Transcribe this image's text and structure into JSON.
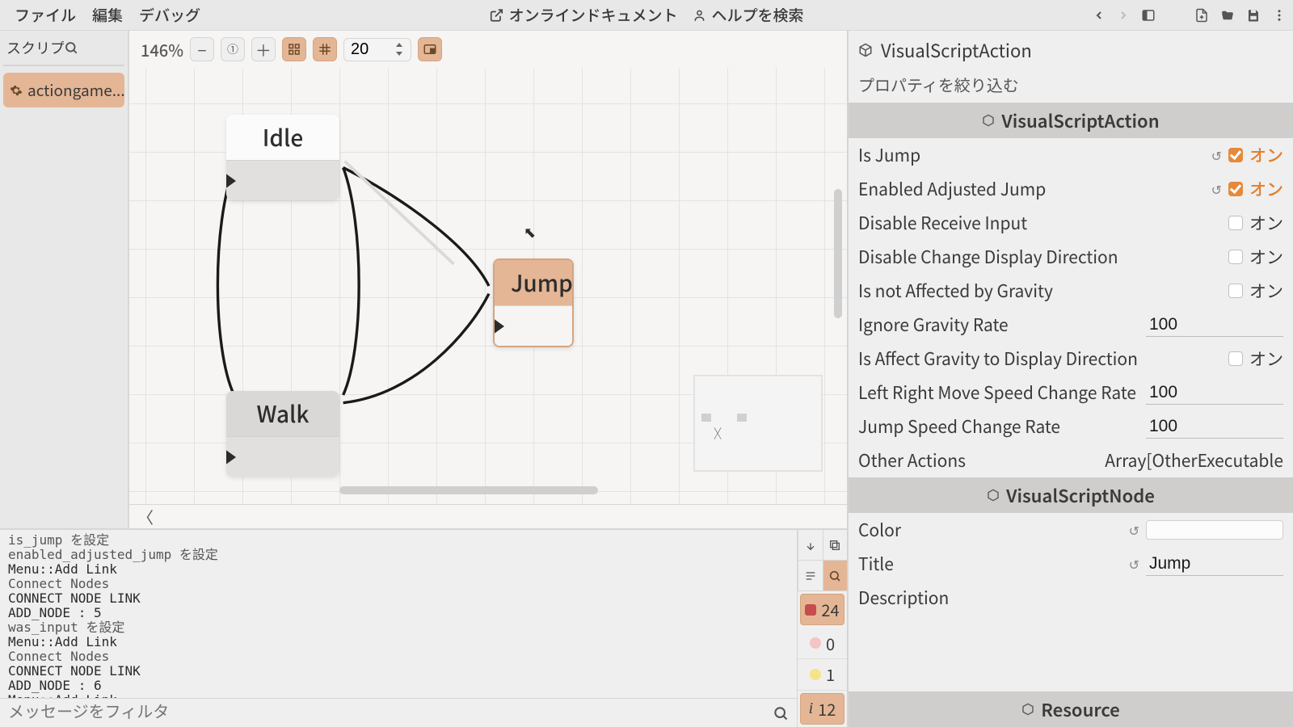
{
  "menu": {
    "file": "ファイル",
    "edit": "編集",
    "debug": "デバッグ",
    "online_docs": "オンラインドキュメント",
    "help": "ヘルプを検索"
  },
  "sidebar": {
    "search_label": "スクリプトを",
    "item": "actiongame..."
  },
  "canvas": {
    "zoom": "146%",
    "grid": "20",
    "nodes": {
      "idle": "Idle",
      "walk": "Walk",
      "jump": "Jump"
    }
  },
  "console": {
    "lines": [
      {
        "t": "is_jump を設定",
        "a": false
      },
      {
        "t": "enabled_adjusted_jump を設定",
        "a": false
      },
      {
        "t": "Menu::Add Link",
        "a": true
      },
      {
        "t": "Connect Nodes",
        "a": false
      },
      {
        "t": "CONNECT NODE LINK",
        "a": true
      },
      {
        "t": "ADD_NODE : 5",
        "a": true
      },
      {
        "t": "was_input を設定",
        "a": false
      },
      {
        "t": "Menu::Add Link",
        "a": true
      },
      {
        "t": "Connect Nodes",
        "a": false
      },
      {
        "t": "CONNECT NODE LINK",
        "a": true
      },
      {
        "t": "ADD_NODE : 6",
        "a": true
      },
      {
        "t": "Menu::Add Link",
        "a": true
      }
    ],
    "filter_placeholder": "メッセージをフィルタ",
    "count_warn": "24",
    "count_error": "0",
    "count_yellow": "1",
    "count_info": "12"
  },
  "inspector": {
    "class": "VisualScriptAction",
    "filter": "プロパティを絞り込む",
    "section1": "VisualScriptAction",
    "props": {
      "is_jump": "Is Jump",
      "enabled_adjusted_jump": "Enabled Adjusted Jump",
      "disable_receive_input": "Disable Receive Input",
      "disable_change_display": "Disable Change Display Direction",
      "not_affected_gravity": "Is not Affected by Gravity",
      "ignore_gravity_rate": "Ignore Gravity Rate",
      "is_affect_gravity_dir": "Is Affect Gravity to Display Direction",
      "lr_move_speed": "Left Right Move Speed Change Rate",
      "jump_speed": "Jump Speed Change Rate",
      "other_actions": "Other Actions",
      "other_actions_val": "Array[OtherExecutable",
      "color": "Color",
      "title": "Title",
      "title_val": "Jump",
      "description": "Description"
    },
    "on": "オン",
    "vals": {
      "ignore_gravity_rate": "100",
      "lr_move_speed": "100",
      "jump_speed": "100"
    },
    "section2": "VisualScriptNode",
    "section3": "Resource"
  }
}
